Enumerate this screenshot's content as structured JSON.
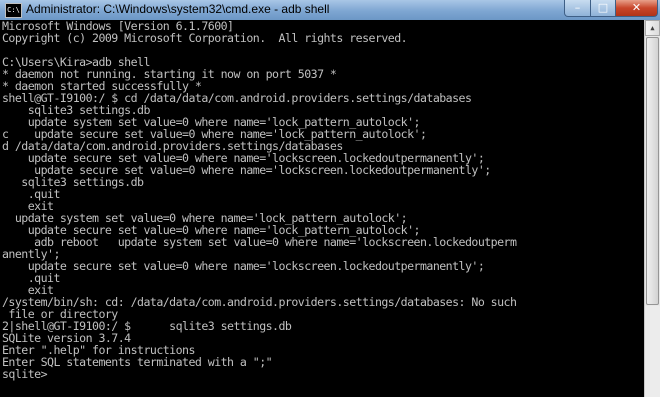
{
  "window": {
    "title": "Administrator: C:\\Windows\\system32\\cmd.exe - adb  shell",
    "icon_label": "C:\\",
    "icon": "cmd-icon",
    "minimize_glyph": "–",
    "maximize_glyph": "□",
    "close_glyph": "✕"
  },
  "console": {
    "lines": [
      "Microsoft Windows [Version 6.1.7600]",
      "Copyright (c) 2009 Microsoft Corporation.  All rights reserved.",
      "",
      "C:\\Users\\Kira>adb shell",
      "* daemon not running. starting it now on port 5037 *",
      "* daemon started successfully *",
      "shell@GT-I9100:/ $ cd /data/data/com.android.providers.settings/databases",
      "    sqlite3 settings.db",
      "    update system set value=0 where name='lock_pattern_autolock';",
      "c    update secure set value=0 where name='lock_pattern_autolock';",
      "d /data/data/com.android.providers.settings/databases",
      "    update secure set value=0 where name='lockscreen.lockedoutpermanently';",
      "     update secure set value=0 where name='lockscreen.lockedoutpermanently';",
      "   sqlite3 settings.db",
      "    .quit",
      "    exit",
      "  update system set value=0 where name='lock_pattern_autolock';",
      "    update secure set value=0 where name='lock_pattern_autolock';",
      "     adb reboot   update system set value=0 where name='lockscreen.lockedoutperm",
      "anently';",
      "    update secure set value=0 where name='lockscreen.lockedoutpermanently';",
      "    .quit",
      "    exit",
      "/system/bin/sh: cd: /data/data/com.android.providers.settings/databases: No such",
      " file or directory",
      "2|shell@GT-I9100:/ $      sqlite3 settings.db",
      "SQLite version 3.7.4",
      "Enter \".help\" for instructions",
      "Enter SQL statements terminated with a \";\"",
      "sqlite>"
    ]
  },
  "scrollbar": {
    "up_arrow_glyph": "▲"
  }
}
